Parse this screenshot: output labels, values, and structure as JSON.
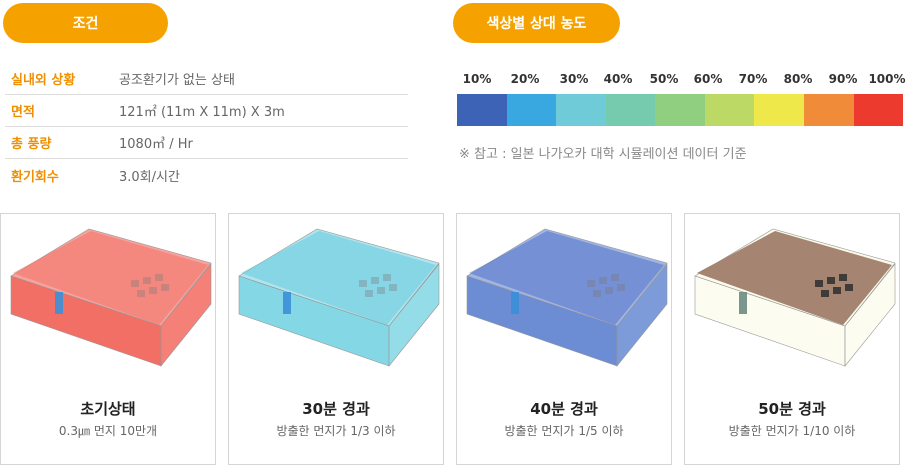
{
  "conditions": {
    "pill_label": "조건",
    "rows": [
      {
        "label": "실내외 상황",
        "value": "공조환기가 없는 상태"
      },
      {
        "label": "면적",
        "value": "121㎡ (11m X 11m) X 3m"
      },
      {
        "label": "총 풍량",
        "value": "1080㎥ / Hr"
      },
      {
        "label": "환기회수",
        "value": "3.0회/시간"
      }
    ]
  },
  "scale": {
    "pill_label": "색상별 상대 농도",
    "ticks": [
      "10%",
      "20%",
      "30%",
      "40%",
      "50%",
      "60%",
      "70%",
      "80%",
      "90%",
      "100%"
    ],
    "colors": [
      "#3c63b6",
      "#3aa8e0",
      "#70cbd8",
      "#76cbae",
      "#91cf80",
      "#bcd966",
      "#eee84a",
      "#f08b3a",
      "#ec3a2e"
    ],
    "note": "※ 참고 : 일본 나가오카 대학 시뮬레이션 데이터 기준"
  },
  "cards": [
    {
      "title": "초기상태",
      "subtitle": "0.3㎛ 먼지 10만개",
      "room_color": "#f0564a",
      "floor_color": "#f26d62"
    },
    {
      "title": "30분 경과",
      "subtitle": "방출한 먼지가 1/3 이하",
      "room_color": "#6fd0e0",
      "floor_color": "#5ec8dc"
    },
    {
      "title": "40분 경과",
      "subtitle": "방출한 먼지가 1/5 이하",
      "room_color": "#5278cc",
      "floor_color": "#4a6cc6"
    },
    {
      "title": "50분 경과",
      "subtitle": "방출한 먼지가 1/10 이하",
      "room_color": "#f6f7d8",
      "floor_color": "#a07e6a"
    }
  ]
}
